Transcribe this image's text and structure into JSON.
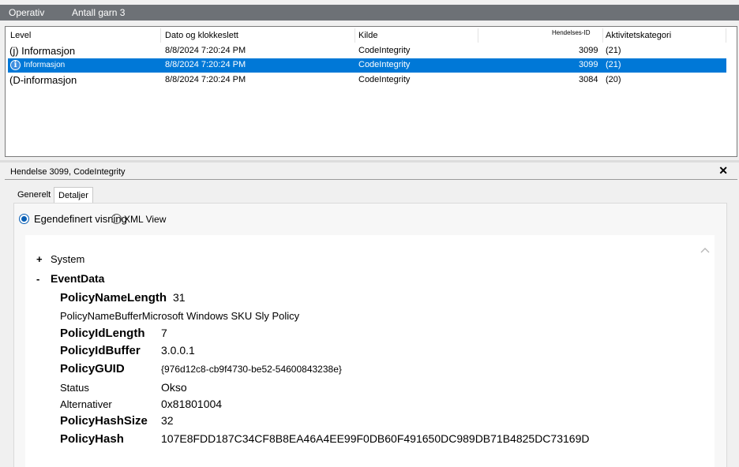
{
  "titlebar": {
    "log_name": "Operativ",
    "event_count": "Antall garn 3"
  },
  "events_table": {
    "columns": [
      "Level",
      "Dato og klokkeslett",
      "Kilde",
      "Hendelses-ID",
      "Aktivitetskategori"
    ],
    "rows": [
      {
        "level": "(j) Informasjon",
        "datetime": "8/8/2024 7:20:24 PM",
        "source": "CodeIntegrity",
        "event_id": "3099",
        "category": "(21)",
        "selected": false
      },
      {
        "level": "Informasjon",
        "datetime": "8/8/2024 7:20:24 PM",
        "source": "CodeIntegrity",
        "event_id": "3099",
        "category": "(21)",
        "selected": true,
        "icon": "info-icon"
      },
      {
        "level": "(D-informasjon",
        "datetime": "8/8/2024 7:20:24 PM",
        "source": "CodeIntegrity",
        "event_id": "3084",
        "category": "(20)",
        "selected": false
      }
    ]
  },
  "detail": {
    "title": "Hendelse 3099, CodeIntegrity",
    "close_glyph": "✕",
    "tabs": [
      "Generelt",
      "Detaljer"
    ],
    "active_tab": "Detaljer",
    "view_options": {
      "friendly": "Egendefinert visning",
      "xml": "XML View",
      "selected": "friendly"
    },
    "tree": {
      "system": {
        "toggle": "+",
        "label": "System"
      },
      "eventdata": {
        "toggle": "-",
        "label": "EventData"
      },
      "fields": [
        {
          "key": "PolicyNameLength",
          "value": "31",
          "bold": true
        },
        {
          "key": "PolicyNameBufferMicrosoft Windows SKU Sly Policy",
          "value": "",
          "bold": false
        },
        {
          "key": "PolicyIdLength",
          "value": "7",
          "bold": true
        },
        {
          "key": "PolicyIdBuffer",
          "value": "3.0.0.1",
          "bold": true
        },
        {
          "key": "PolicyGUID",
          "value": "{976d12c8-cb9f4730-be52-54600843238e}",
          "bold": true
        },
        {
          "key": "Status",
          "value": "Okso",
          "bold": false
        },
        {
          "key": "Alternativer",
          "value": "0x81801004",
          "bold": false
        },
        {
          "key": "PolicyHashSize",
          "value": "32",
          "bold": true
        },
        {
          "key": "PolicyHash",
          "value": "107E8FDD187C34CF8B8EA46A4EE99F0DB60F491650DC989DB71B4825DC73169D",
          "bold": true
        }
      ]
    }
  },
  "colors": {
    "titlebar": "#6d7176",
    "selection": "#0078d7",
    "radio_accent": "#0a5fb4"
  }
}
